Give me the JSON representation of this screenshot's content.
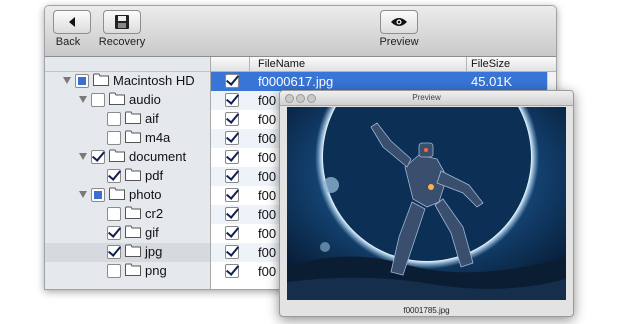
{
  "toolbar": {
    "back_label": "Back",
    "recovery_label": "Recovery",
    "preview_label": "Preview"
  },
  "tree": [
    {
      "label": "Macintosh HD",
      "state": "mixed",
      "expanded": true,
      "level": 0
    },
    {
      "label": "audio",
      "state": "unchecked",
      "expanded": true,
      "level": 1
    },
    {
      "label": "aif",
      "state": "unchecked",
      "level": 2
    },
    {
      "label": "m4a",
      "state": "unchecked",
      "level": 2
    },
    {
      "label": "document",
      "state": "checked",
      "expanded": true,
      "level": 1
    },
    {
      "label": "pdf",
      "state": "checked",
      "level": 2
    },
    {
      "label": "photo",
      "state": "mixed",
      "expanded": true,
      "level": 1
    },
    {
      "label": "cr2",
      "state": "unchecked",
      "level": 2
    },
    {
      "label": "gif",
      "state": "checked",
      "level": 2
    },
    {
      "label": "jpg",
      "state": "checked",
      "level": 2,
      "selected": true
    },
    {
      "label": "png",
      "state": "unchecked",
      "level": 2
    }
  ],
  "file_list": {
    "columns": [
      "FileName",
      "FileSize"
    ],
    "rows": [
      {
        "name": "f0000617.jpg",
        "size": "45.01K",
        "checked": true,
        "selected": true
      },
      {
        "name": "f00",
        "size": "",
        "checked": true
      },
      {
        "name": "f00",
        "size": "",
        "checked": true
      },
      {
        "name": "f00",
        "size": "",
        "checked": true
      },
      {
        "name": "f00",
        "size": "",
        "checked": true
      },
      {
        "name": "f00",
        "size": "",
        "checked": true
      },
      {
        "name": "f00",
        "size": "",
        "checked": true
      },
      {
        "name": "f00",
        "size": "",
        "checked": true
      },
      {
        "name": "f00",
        "size": "",
        "checked": true
      },
      {
        "name": "f00",
        "size": "",
        "checked": true
      },
      {
        "name": "f00",
        "size": "",
        "checked": true
      }
    ]
  },
  "preview": {
    "title": "Preview",
    "filename": "f0001785.jpg"
  },
  "icons": {
    "back": "back-arrow-icon",
    "recovery": "floppy-disk-icon",
    "preview": "eye-icon",
    "folder": "folder-icon"
  },
  "colors": {
    "selection": "#3875d7",
    "sidebar": "#e5e9ee"
  }
}
